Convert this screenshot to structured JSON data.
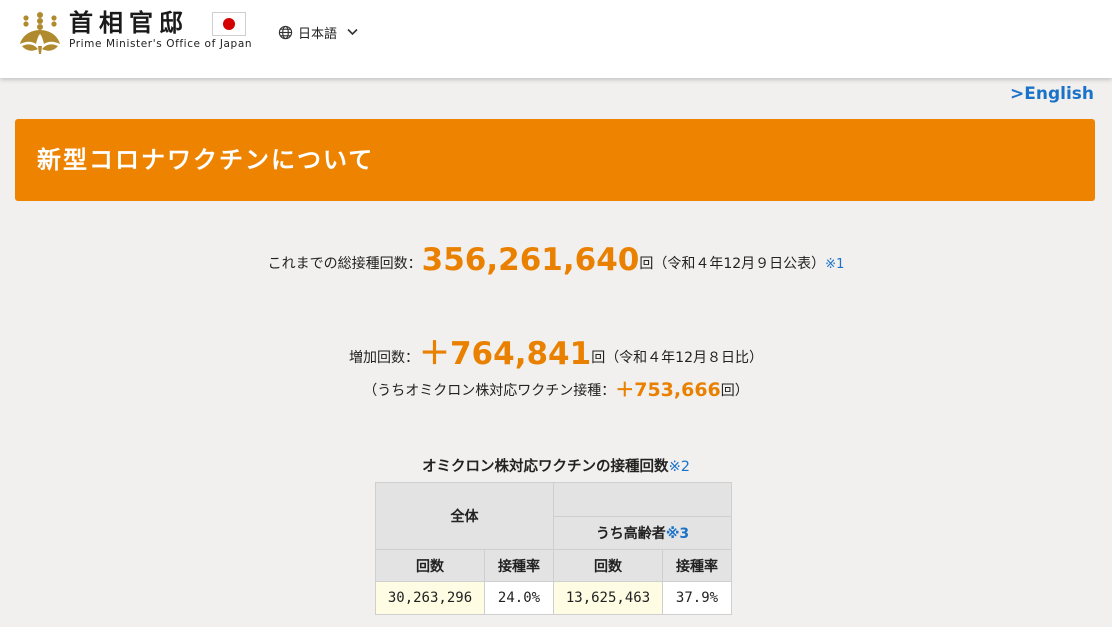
{
  "header": {
    "title_jp": "首相官邸",
    "title_en": "Prime Minister's Office of Japan",
    "language": "日本語",
    "icons": [
      "paulownia-emblem-icon",
      "japan-flag-icon",
      "globe-icon",
      "chevron-down-icon"
    ]
  },
  "english_link": ">English",
  "banner": {
    "title": "新型コロナワクチンについて"
  },
  "total": {
    "label": "これまでの総接種回数：",
    "value": "356,261,640",
    "unit": "回",
    "date_note": "（令和４年12月９日公表）",
    "footnote": "※1"
  },
  "increase": {
    "label": "増加回数：",
    "value": "＋764,841",
    "unit": "回",
    "date_note": "（令和４年12月８日比）"
  },
  "omicron_increase": {
    "prefix": "（うちオミクロン株対応ワクチン接種：",
    "value": "＋753,666",
    "suffix": "回）"
  },
  "table": {
    "title": "オミクロン株対応ワクチンの接種回数",
    "footnote": "※2",
    "group_all": "全体",
    "group_elderly": "うち高齢者",
    "group_elderly_note": "※3",
    "col_count": "回数",
    "col_rate": "接種率",
    "row": {
      "all_count": "30,263,296",
      "all_rate": "24.0%",
      "elderly_count": "13,625,463",
      "elderly_rate": "37.9%"
    }
  },
  "colors": {
    "accent_orange": "#ee8300",
    "link_blue": "#1b73c9",
    "flag_red": "#d40000",
    "background": "#f1f0ee"
  }
}
